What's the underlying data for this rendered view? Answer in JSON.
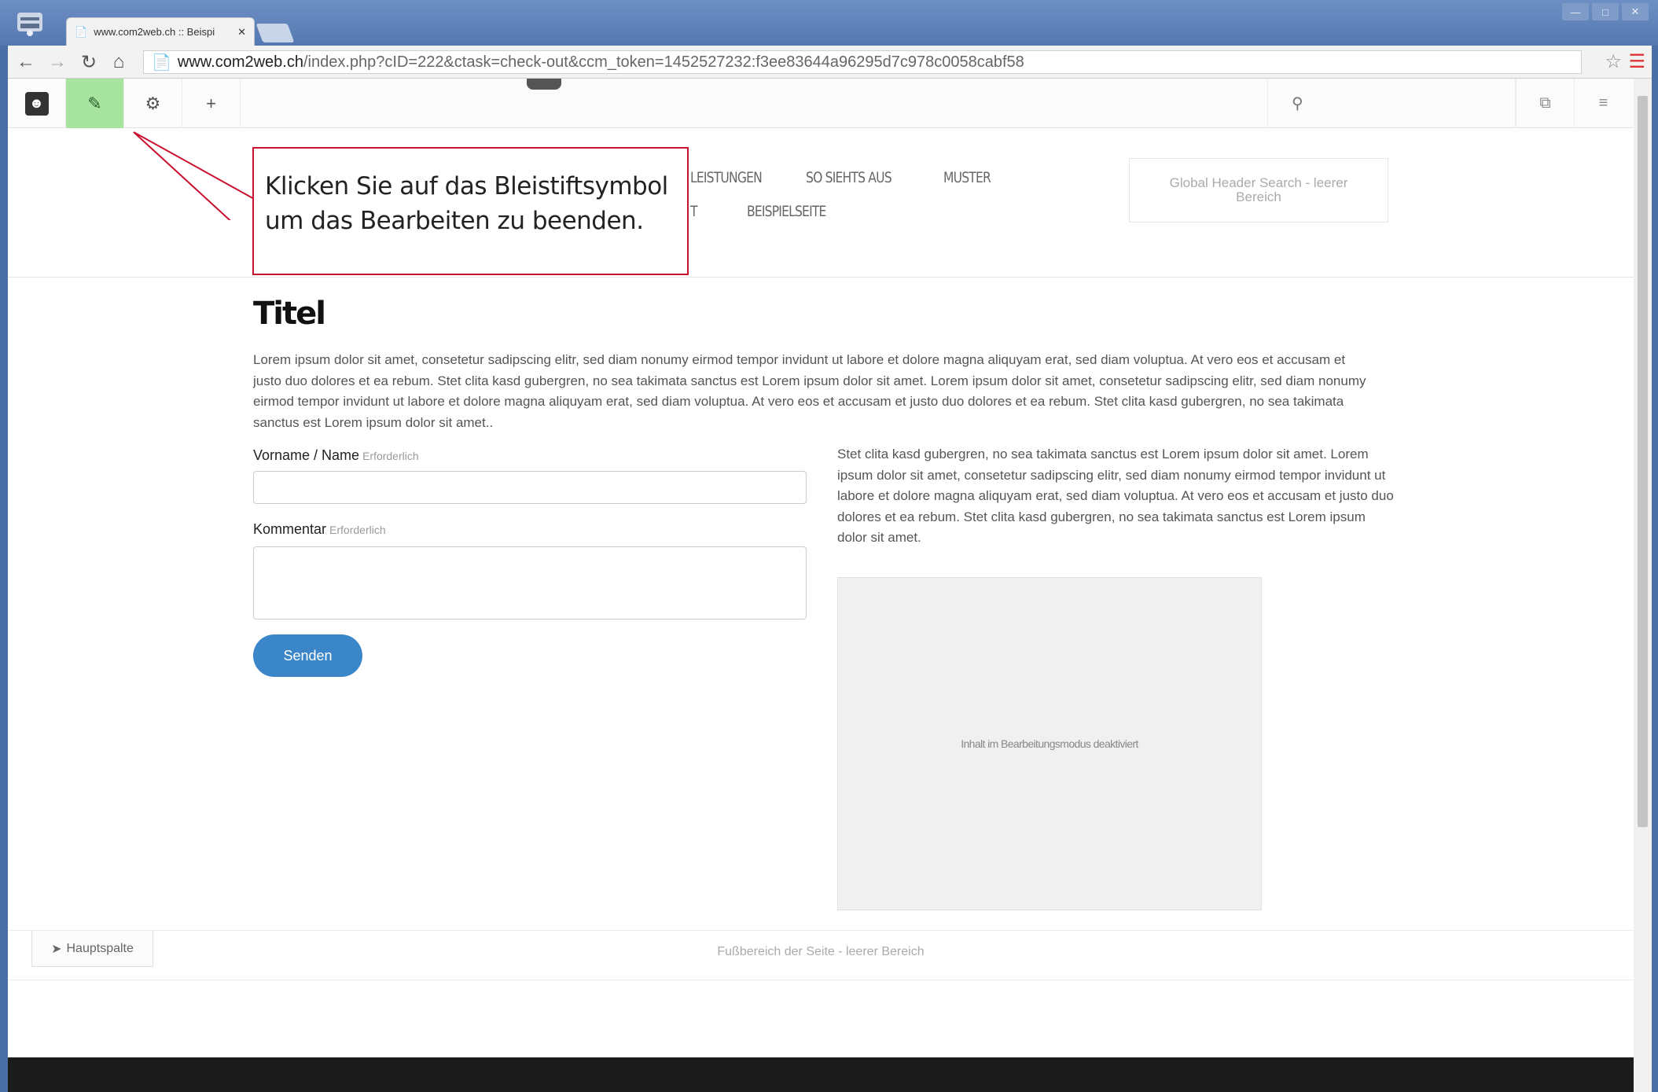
{
  "browser": {
    "tab_title": "www.com2web.ch :: Beispi",
    "url_domain": "www.com2web.ch",
    "url_path": "/index.php?cID=222&ctask=check-out&ccm_token=1452527232:f3ee83644a96295d7c978c0058cabf58"
  },
  "cms_toolbar": {
    "search_icon": "search-icon"
  },
  "nav": {
    "items_row1": [
      "LEISTUNGEN",
      "SO SIEHTS AUS",
      "MUSTER"
    ],
    "items_row2": [
      "T",
      "BEISPIELSEITE"
    ],
    "header_search_placeholder": "Global Header Search - leerer Bereich"
  },
  "callout": {
    "text": "Klicken Sie auf das Bleistiftsymbol um das Bearbeiten zu beenden."
  },
  "content": {
    "title": "Titel",
    "lead": "Lorem ipsum dolor sit amet, consetetur sadipscing elitr, sed diam nonumy eirmod tempor invidunt ut labore et dolore magna aliquyam erat, sed diam voluptua. At vero eos et accusam et justo duo dolores et ea rebum. Stet clita kasd gubergren, no sea takimata sanctus est Lorem ipsum dolor sit amet. Lorem ipsum dolor sit amet, consetetur sadipscing elitr, sed diam nonumy eirmod tempor invidunt ut labore et dolore magna aliquyam erat, sed diam voluptua. At vero eos et accusam et justo duo dolores et ea rebum. Stet clita kasd gubergren, no sea takimata sanctus est Lorem ipsum dolor sit amet..",
    "side_text": "Stet clita kasd gubergren, no sea takimata sanctus est Lorem ipsum dolor sit amet. Lorem ipsum dolor sit amet, consetetur sadipscing elitr, sed diam nonumy eirmod tempor invidunt ut labore et dolore magna aliquyam erat, sed diam voluptua. At vero eos et accusam et justo duo dolores et ea rebum. Stet clita kasd gubergren, no sea takimata sanctus est Lorem ipsum dolor sit amet.",
    "placeholder_text": "Inhalt im Bearbeitungsmodus deaktiviert"
  },
  "form": {
    "name_label": "Vorname / Name",
    "name_required": "Erforderlich",
    "comment_label": "Kommentar",
    "comment_required": "Erforderlich",
    "submit_label": "Senden"
  },
  "footer": {
    "area_tab": "Hauptspalte",
    "footer_text": "Fußbereich der Seite - leerer Bereich"
  },
  "colors": {
    "edit_active": "#a6e4a0",
    "callout_border": "#c8102e",
    "button": "#3b86c9"
  }
}
